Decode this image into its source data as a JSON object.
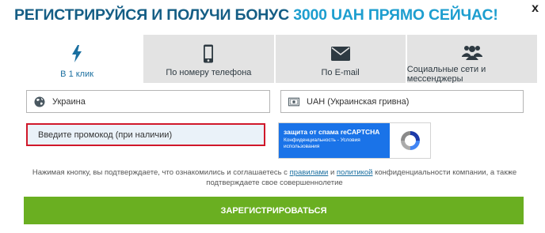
{
  "header": {
    "title_main": "РЕГИСТРИРУЙСЯ И ПОЛУЧИ БОНУС ",
    "title_accent": "3000 UAH ПРЯМО СЕЙЧАС!",
    "close_label": "x"
  },
  "tabs": [
    {
      "label": "В 1 клик",
      "icon": "lightning-icon",
      "active": true
    },
    {
      "label": "По номеру телефона",
      "icon": "phone-icon",
      "active": false
    },
    {
      "label": "По E-mail",
      "icon": "envelope-icon",
      "active": false
    },
    {
      "label": "Социальные сети и мессенджеры",
      "icon": "users-icon",
      "active": false
    }
  ],
  "form": {
    "country": "Украина",
    "currency": "UAH (Украинская гривна)",
    "promo_placeholder": "Введите промокод (при наличии)"
  },
  "captcha": {
    "title": "защита от спама reCAPTCHA",
    "subtitle": "Конфиденциальность - Условия использования"
  },
  "legal": {
    "text_before": "Нажимая кнопку, вы подтверждаете, что ознакомились и соглашаетесь с ",
    "link_rules": "правилами",
    "text_and": " и ",
    "link_policy": "политикой",
    "text_after": " конфиденциальности компании, а также подтверждаете свое совершеннолетие"
  },
  "submit_label": "ЗАРЕГИСТРИРОВАТЬСЯ",
  "colors": {
    "title": "#155e85",
    "accent": "#1d9ecf",
    "tab_inactive": "#e3e3e3",
    "highlight_border": "#d0182a",
    "submit": "#6aaf21",
    "recaptcha": "#1a73e8"
  }
}
